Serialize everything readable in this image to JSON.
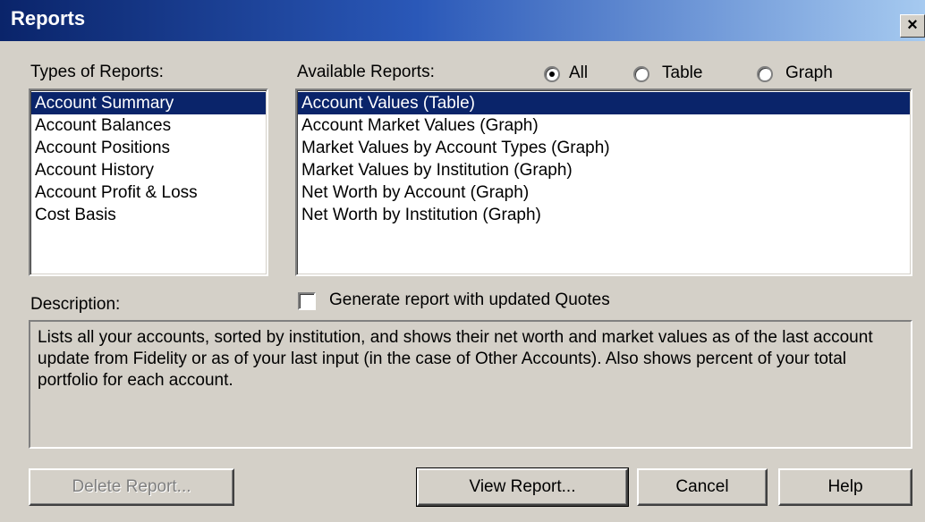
{
  "window": {
    "title": "Reports",
    "close_glyph": "×"
  },
  "types_label": "Types of Reports:",
  "types": [
    {
      "label": "Account Summary",
      "selected": true
    },
    {
      "label": "Account Balances",
      "selected": false
    },
    {
      "label": "Account Positions",
      "selected": false
    },
    {
      "label": "Account History",
      "selected": false
    },
    {
      "label": "Account Profit & Loss",
      "selected": false
    },
    {
      "label": "Cost Basis",
      "selected": false
    }
  ],
  "available_label": "Available Reports:",
  "filter": {
    "options": [
      {
        "label": "All",
        "checked": true
      },
      {
        "label": "Table",
        "checked": false
      },
      {
        "label": "Graph",
        "checked": false
      }
    ]
  },
  "available": [
    {
      "label": "Account Values (Table)",
      "selected": true
    },
    {
      "label": "Account Market Values (Graph)",
      "selected": false
    },
    {
      "label": "Market Values by Account Types (Graph)",
      "selected": false
    },
    {
      "label": "Market Values by Institution (Graph)",
      "selected": false
    },
    {
      "label": "Net Worth by Account (Graph)",
      "selected": false
    },
    {
      "label": "Net Worth by Institution (Graph)",
      "selected": false
    }
  ],
  "description_label": "Description:",
  "updated_quotes": {
    "label": "Generate report with updated Quotes",
    "checked": false
  },
  "description_text": "Lists all your accounts, sorted by institution, and shows their net worth and market values as of the last account update from Fidelity or as of your last input (in the case of Other Accounts). Also shows percent of your total portfolio for each account.",
  "buttons": {
    "delete": "Delete Report...",
    "view": "View Report...",
    "cancel": "Cancel",
    "help": "Help"
  },
  "colors": {
    "title_start": "#0a246a",
    "title_end": "#a6caf0",
    "selection": "#0a246a",
    "face": "#d4d0c8"
  },
  "icons": {
    "close": "close-icon"
  }
}
